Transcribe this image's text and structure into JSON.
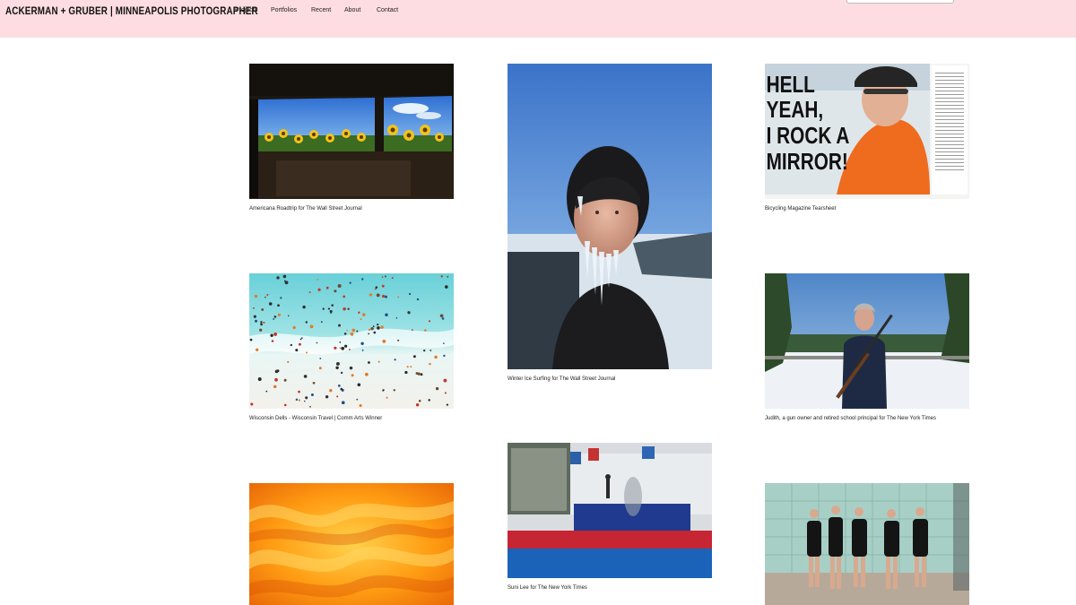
{
  "header": {
    "site_title": "ACKERMAN + GRUBER | MINNEAPOLIS PHOTOGRAPHER",
    "search_placeholder": ""
  },
  "nav": {
    "items": [
      {
        "label": "Projects"
      },
      {
        "label": "Portfolios"
      },
      {
        "label": "Recent"
      },
      {
        "label": "About"
      },
      {
        "label": "Contact"
      }
    ]
  },
  "gallery": {
    "items": [
      {
        "caption": "Americana Roadtrip for The Wall Street Journal"
      },
      {
        "caption": "Winter Ice Surfing for The Wall Street Journal"
      },
      {
        "caption": "Bicycling Magazine Tearsheet",
        "headline": [
          "HELL",
          "YEAH,",
          "I ROCK A",
          "MIRROR!"
        ]
      },
      {
        "caption": "Wisconsin Dells - Wisconsin Travel | Comm Arts Winner"
      },
      {
        "caption": "Judith, a gun owner and retired school principal for The New York Times"
      },
      {
        "caption": ""
      },
      {
        "caption": "Suni Lee for The New York Times"
      },
      {
        "caption": ""
      }
    ]
  },
  "colors": {
    "header_bg": "#fddde1",
    "page_bg": "#ffffff",
    "text": "#111111"
  }
}
